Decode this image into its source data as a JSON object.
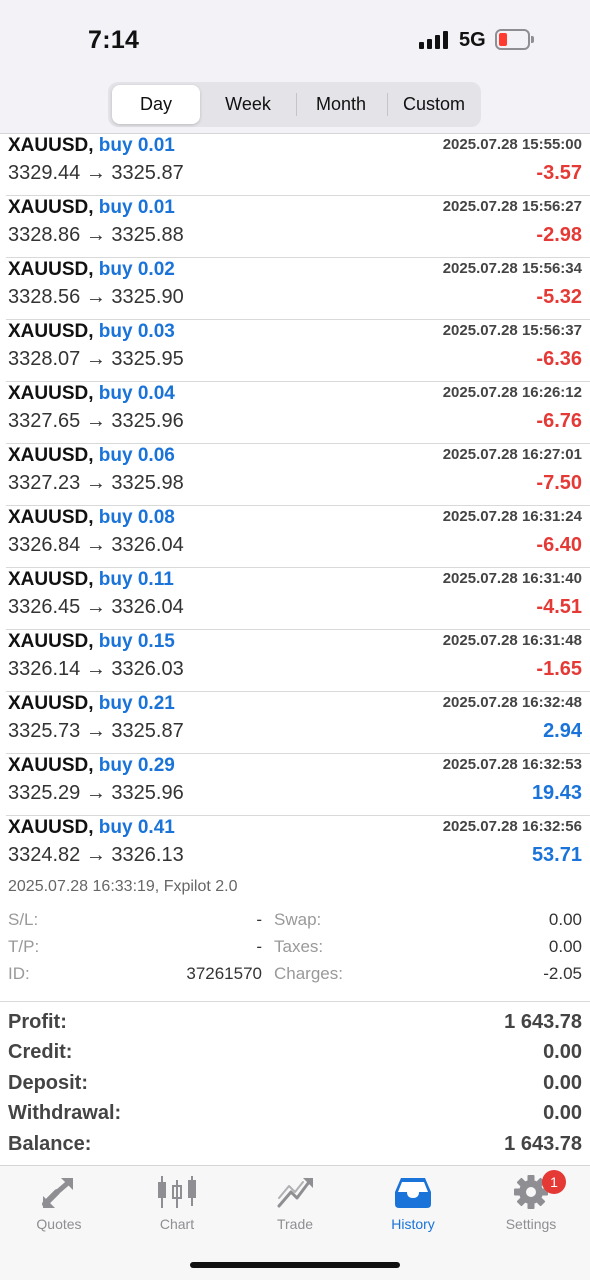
{
  "status_bar": {
    "time": "7:14",
    "network": "5G",
    "battery_color": "#ff3b30"
  },
  "segments": [
    {
      "label": "Day",
      "active": true
    },
    {
      "label": "Week",
      "active": false
    },
    {
      "label": "Month",
      "active": false
    },
    {
      "label": "Custom",
      "active": false
    }
  ],
  "trades": [
    {
      "symbol": "XAUUSD,",
      "side": "buy 0.01",
      "datetime": "2025.07.28 15:55:00",
      "prices": "3329.44 → 3325.87",
      "profit": "-3.57"
    },
    {
      "symbol": "XAUUSD,",
      "side": "buy 0.01",
      "datetime": "2025.07.28 15:56:27",
      "prices": "3328.86 → 3325.88",
      "profit": "-2.98"
    },
    {
      "symbol": "XAUUSD,",
      "side": "buy 0.02",
      "datetime": "2025.07.28 15:56:34",
      "prices": "3328.56 → 3325.90",
      "profit": "-5.32"
    },
    {
      "symbol": "XAUUSD,",
      "side": "buy 0.03",
      "datetime": "2025.07.28 15:56:37",
      "prices": "3328.07 → 3325.95",
      "profit": "-6.36"
    },
    {
      "symbol": "XAUUSD,",
      "side": "buy 0.04",
      "datetime": "2025.07.28 16:26:12",
      "prices": "3327.65 → 3325.96",
      "profit": "-6.76"
    },
    {
      "symbol": "XAUUSD,",
      "side": "buy 0.06",
      "datetime": "2025.07.28 16:27:01",
      "prices": "3327.23 → 3325.98",
      "profit": "-7.50"
    },
    {
      "symbol": "XAUUSD,",
      "side": "buy 0.08",
      "datetime": "2025.07.28 16:31:24",
      "prices": "3326.84 → 3326.04",
      "profit": "-6.40"
    },
    {
      "symbol": "XAUUSD,",
      "side": "buy 0.11",
      "datetime": "2025.07.28 16:31:40",
      "prices": "3326.45 → 3326.04",
      "profit": "-4.51"
    },
    {
      "symbol": "XAUUSD,",
      "side": "buy 0.15",
      "datetime": "2025.07.28 16:31:48",
      "prices": "3326.14 → 3326.03",
      "profit": "-1.65"
    },
    {
      "symbol": "XAUUSD,",
      "side": "buy 0.21",
      "datetime": "2025.07.28 16:32:48",
      "prices": "3325.73 → 3325.87",
      "profit": "2.94"
    },
    {
      "symbol": "XAUUSD,",
      "side": "buy 0.29",
      "datetime": "2025.07.28 16:32:53",
      "prices": "3325.29 → 3325.96",
      "profit": "19.43"
    },
    {
      "symbol": "XAUUSD,",
      "side": "buy 0.41",
      "datetime": "2025.07.28 16:32:56",
      "prices": "3324.82 → 3326.13",
      "profit": "53.71"
    }
  ],
  "details": {
    "header": "2025.07.28 16:33:19, Fxpilot 2.0",
    "sl_label": "S/L:",
    "sl_value": "-",
    "tp_label": "T/P:",
    "tp_value": "-",
    "id_label": "ID:",
    "id_value": "37261570",
    "swap_label": "Swap:",
    "swap_value": "0.00",
    "taxes_label": "Taxes:",
    "taxes_value": "0.00",
    "charges_label": "Charges:",
    "charges_value": "-2.05"
  },
  "summary": [
    {
      "label": "Profit:",
      "value": "1 643.78"
    },
    {
      "label": "Credit:",
      "value": "0.00"
    },
    {
      "label": "Deposit:",
      "value": "0.00"
    },
    {
      "label": "Withdrawal:",
      "value": "0.00"
    },
    {
      "label": "Balance:",
      "value": "1 643.78"
    }
  ],
  "tabs": [
    {
      "label": "Quotes",
      "icon": "quotes-icon"
    },
    {
      "label": "Chart",
      "icon": "candlestick-icon"
    },
    {
      "label": "Trade",
      "icon": "trade-icon"
    },
    {
      "label": "History",
      "icon": "history-inbox-icon",
      "active": true
    },
    {
      "label": "Settings",
      "icon": "gear-icon",
      "badge": "1"
    }
  ],
  "colors": {
    "accent": "#1a73d9",
    "loss": "#e53935",
    "badge": "#e53935"
  }
}
